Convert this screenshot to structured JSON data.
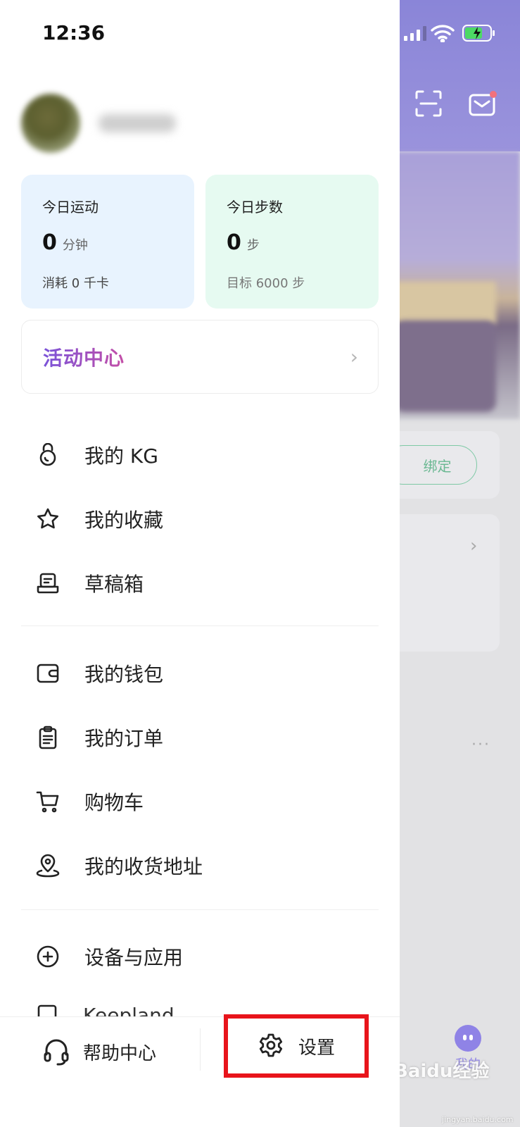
{
  "status_bar": {
    "time": "12:36"
  },
  "drawer": {
    "stats": [
      {
        "title": "今日运动",
        "value": "0",
        "unit": "分钟",
        "sub": "消耗 0 千卡"
      },
      {
        "title": "今日步数",
        "value": "0",
        "unit": "步",
        "sub": "目标 6000 步"
      }
    ],
    "activity_center": {
      "label": "活动中心"
    },
    "menu_group_1": [
      {
        "label": "我的 KG",
        "icon": "kettlebell-icon"
      },
      {
        "label": "我的收藏",
        "icon": "star-icon"
      },
      {
        "label": "草稿箱",
        "icon": "drafts-icon"
      }
    ],
    "menu_group_2": [
      {
        "label": "我的钱包",
        "icon": "wallet-icon"
      },
      {
        "label": "我的订单",
        "icon": "order-clipboard-icon"
      },
      {
        "label": "购物车",
        "icon": "cart-icon"
      },
      {
        "label": "我的收货地址",
        "icon": "location-pin-icon"
      }
    ],
    "menu_group_3": [
      {
        "label": "设备与应用",
        "icon": "plus-circle-icon"
      }
    ],
    "peek_item_label": "Keepland",
    "bottom": {
      "help_label": "帮助中心",
      "settings_label": "设置"
    }
  },
  "background_app": {
    "bind_button": "绑定",
    "tab_label": "我的",
    "more_dots": "···"
  },
  "watermark": {
    "text": "Baidu经验",
    "sub": "jingyan.baidu.com"
  },
  "colors": {
    "accent_purple": "#8f83e6",
    "highlight_red": "#e8141b",
    "bind_green": "#6ab892"
  }
}
